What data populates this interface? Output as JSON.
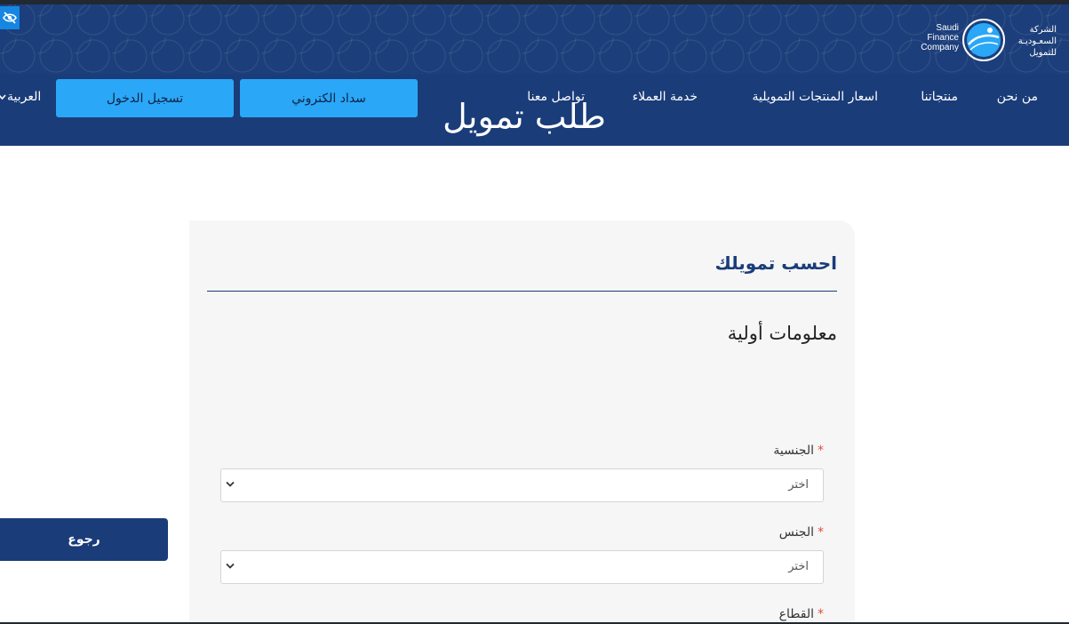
{
  "header": {
    "logo": {
      "english_lines": [
        "Saudi",
        "Finance",
        "Company"
      ],
      "arabic_lines": [
        "الشركة",
        "السعـوديـة",
        "للتمويل"
      ]
    },
    "nav": {
      "about": "من نحن",
      "products": "منتجاتنا",
      "prices": "اسعار المنتجات التمويلية",
      "service": "خدمة العملاء",
      "contact": "تواصل معنا"
    },
    "buttons": {
      "pay": "سداد الكتروني",
      "login": "تسجيل الدخول"
    },
    "language": "العربية",
    "banner_title": "طلب تمويل",
    "icons": {
      "accessibility": "eye-slash-icon",
      "language_caret": "chevron-down-icon"
    }
  },
  "back_button": "رجوع",
  "card": {
    "title": "احسب تمويلك",
    "section": "معلومات أولية",
    "fields": [
      {
        "label": "الجنسية",
        "required_mark": "*",
        "value": "اختر"
      },
      {
        "label": "الجنس",
        "required_mark": "*",
        "value": "اختر"
      },
      {
        "label": "القطاع",
        "required_mark": "*"
      }
    ]
  },
  "colors": {
    "header_bg": "#1c3e7a",
    "accent_button": "#2aa7f7",
    "primary_dark": "#1a3c79",
    "required": "#e74c3c"
  }
}
